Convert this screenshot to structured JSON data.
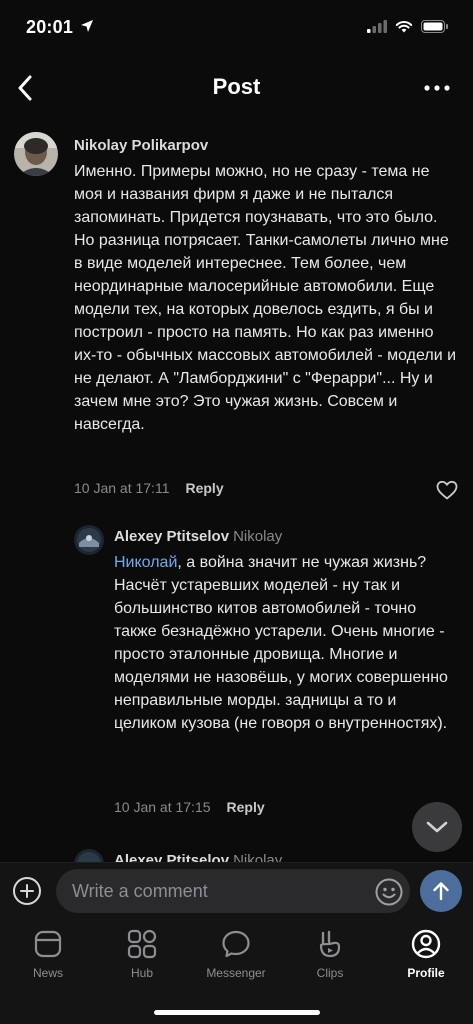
{
  "status_bar": {
    "time": "20:01"
  },
  "header": {
    "title": "Post"
  },
  "comments": [
    {
      "author": "Nikolay Polikarpov",
      "reply_to": "",
      "text": "Именно. Примеры можно, но не сразу - тема не моя и названия фирм я даже и не пытался запоминать. Придется поузнавать, что это было. Но разница потрясает. Танки-самолеты лично мне в виде моделей интереснее. Тем более, чем неординарные малосерийные автомобили. Еще модели тех, на которых довелось ездить, я бы и построил - просто на память. Но как раз именно их-то - обычных массовых автомобилей - модели и не делают. А \"Ламборджини\" с \"Ферарри\"... Ну и зачем мне это? Это чужая жизнь. Совсем и навсегда.",
      "timestamp": "10 Jan at 17:11",
      "reply_label": "Reply"
    },
    {
      "author": "Alexey Ptitselov",
      "reply_to": "Nikolay",
      "mention": "Николай",
      "text": ", а война значит не чужая жизнь?\nНасчёт устаревших моделей - ну так и большинство китов автомобилей - точно также безнадёжно устарели. Очень многие - просто эталонные дровища. Многие и моделями не назовёшь, у могих совершенно неправильные морды. задницы а то и целиком кузова (не говоря о внутренностях).",
      "timestamp": "10 Jan at 17:15",
      "reply_label": "Reply"
    },
    {
      "author": "Alexey Ptitselov",
      "reply_to": "Nikolay"
    }
  ],
  "composer": {
    "placeholder": "Write a comment"
  },
  "tabs": [
    {
      "label": "News",
      "icon": "news-icon",
      "active": false
    },
    {
      "label": "Hub",
      "icon": "hub-icon",
      "active": false
    },
    {
      "label": "Messenger",
      "icon": "messenger-icon",
      "active": false
    },
    {
      "label": "Clips",
      "icon": "clips-icon",
      "active": false
    },
    {
      "label": "Profile",
      "icon": "profile-icon",
      "active": true
    }
  ],
  "colors": {
    "accent": "#71aaeb",
    "send": "#4d6e9c",
    "background": "#0b0b0c"
  }
}
